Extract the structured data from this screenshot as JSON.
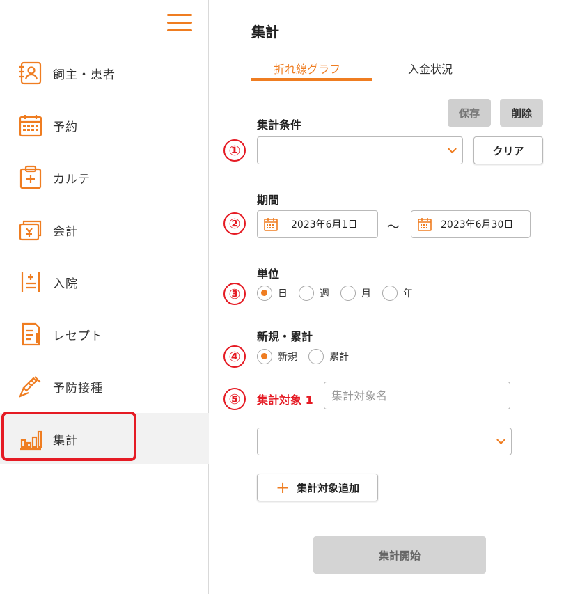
{
  "sidebar": {
    "items": [
      {
        "label": "飼主・患者",
        "icon": "patient-card-icon"
      },
      {
        "label": "予約",
        "icon": "calendar-icon"
      },
      {
        "label": "カルテ",
        "icon": "medical-record-icon"
      },
      {
        "label": "会計",
        "icon": "accounting-icon"
      },
      {
        "label": "入院",
        "icon": "hospitalization-icon"
      },
      {
        "label": "レセプト",
        "icon": "receipt-icon"
      },
      {
        "label": "予防接種",
        "icon": "syringe-icon"
      },
      {
        "label": "集計",
        "icon": "bar-chart-icon"
      }
    ],
    "active_index": 7
  },
  "main": {
    "title": "集計",
    "tabs": [
      {
        "label": "折れ線グラフ",
        "active": true
      },
      {
        "label": "入金状況",
        "active": false
      }
    ],
    "save_label": "保存",
    "delete_label": "削除",
    "conditions_label": "集計条件",
    "clear_label": "クリア",
    "period_label": "期間",
    "date_from": "2023年6月1日",
    "date_separator": "～",
    "date_to": "2023年6月30日",
    "unit_label": "単位",
    "unit_options": [
      "日",
      "週",
      "月",
      "年"
    ],
    "unit_selected": "日",
    "newcum_label": "新規・累計",
    "newcum_options": [
      "新規",
      "累計"
    ],
    "newcum_selected": "新規",
    "target_label": "集計対象 1",
    "target_placeholder": "集計対象名",
    "add_target_label": "集計対象追加",
    "start_label": "集計開始"
  },
  "markers": [
    "①",
    "②",
    "③",
    "④",
    "⑤"
  ],
  "colors": {
    "accent": "#ef7d21",
    "highlight": "#e51b24"
  }
}
